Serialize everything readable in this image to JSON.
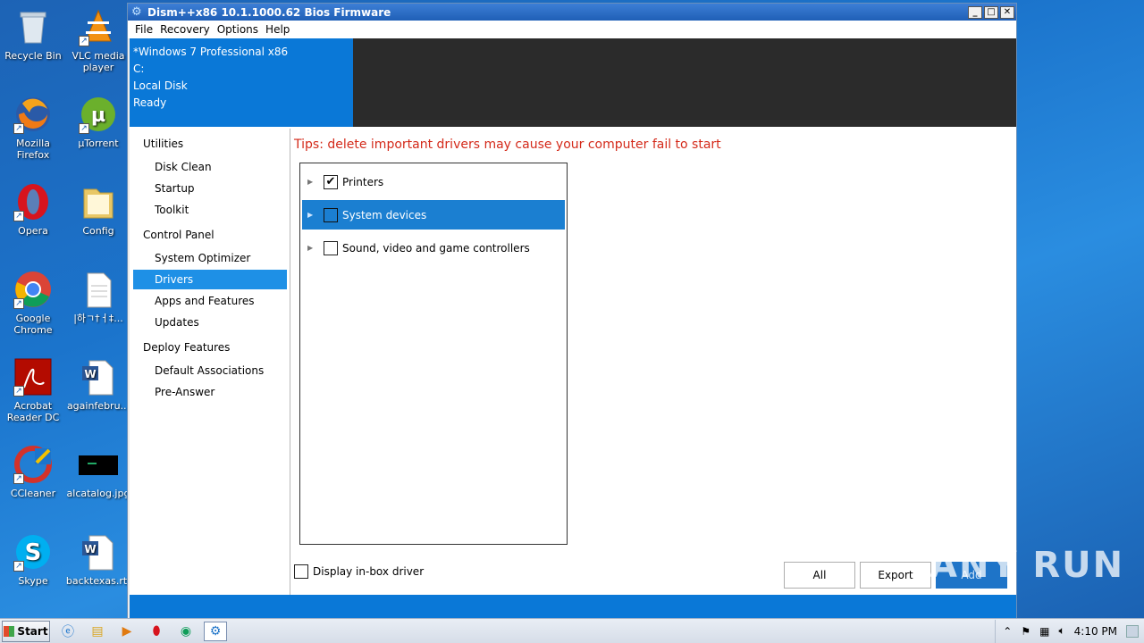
{
  "desktop": {
    "icons": [
      {
        "name": "recycle-bin-icon",
        "label": "Recycle Bin"
      },
      {
        "name": "vlc-icon",
        "label": "VLC media player"
      },
      {
        "name": "firefox-icon",
        "label": "Mozilla Firefox"
      },
      {
        "name": "utorrent-icon",
        "label": "µTorrent"
      },
      {
        "name": "opera-icon",
        "label": "Opera"
      },
      {
        "name": "folder-icon",
        "label": "Config"
      },
      {
        "name": "chrome-icon",
        "label": "Google Chrome"
      },
      {
        "name": "document-icon",
        "label": "|하ㄱ†ㅓ‡..."
      },
      {
        "name": "acrobat-icon",
        "label": "Acrobat Reader DC"
      },
      {
        "name": "word-doc-icon",
        "label": "againfebru..."
      },
      {
        "name": "ccleaner-icon",
        "label": "CCleaner"
      },
      {
        "name": "image-file-icon",
        "label": "alcatalog.jpg"
      },
      {
        "name": "skype-icon",
        "label": "Skype"
      },
      {
        "name": "word-doc-icon-2",
        "label": "backtexas.rtf"
      }
    ]
  },
  "window": {
    "title": "Dism++x86 10.1.1000.62 Bios Firmware",
    "controls": {
      "minimize": "_",
      "maximize": "□",
      "close": "✕"
    },
    "menu": [
      "File",
      "Recovery",
      "Options",
      "Help"
    ]
  },
  "header": {
    "os": "*Windows 7 Professional x86",
    "drive": "C:",
    "disk": "Local Disk",
    "status": "Ready"
  },
  "sidebar": {
    "groups": [
      {
        "label": "Utilities",
        "items": [
          "Disk Clean",
          "Startup",
          "Toolkit"
        ]
      },
      {
        "label": "Control Panel",
        "items": [
          "System Optimizer",
          "Drivers",
          "Apps and Features",
          "Updates"
        ]
      },
      {
        "label": "Deploy Features",
        "items": [
          "Default Associations",
          "Pre-Answer"
        ]
      }
    ],
    "active_item": "Drivers"
  },
  "main": {
    "tips": "Tips: delete important drivers may cause your computer fail to start",
    "tree": [
      {
        "label": "Printers",
        "checked": true,
        "selected": false
      },
      {
        "label": "System devices",
        "checked": false,
        "selected": true
      },
      {
        "label": "Sound, video and game controllers",
        "checked": false,
        "selected": false
      }
    ],
    "display_inbox_label": "Display in-box driver",
    "buttons": {
      "all": "All",
      "export": "Export",
      "add": "Add"
    }
  },
  "watermark": "ANY RUN",
  "taskbar": {
    "start_label": "Start",
    "clock": "4:10 PM"
  },
  "colors": {
    "accent": "#0a78d7",
    "selection": "#1b7fd1",
    "tips": "#d42a1a"
  }
}
